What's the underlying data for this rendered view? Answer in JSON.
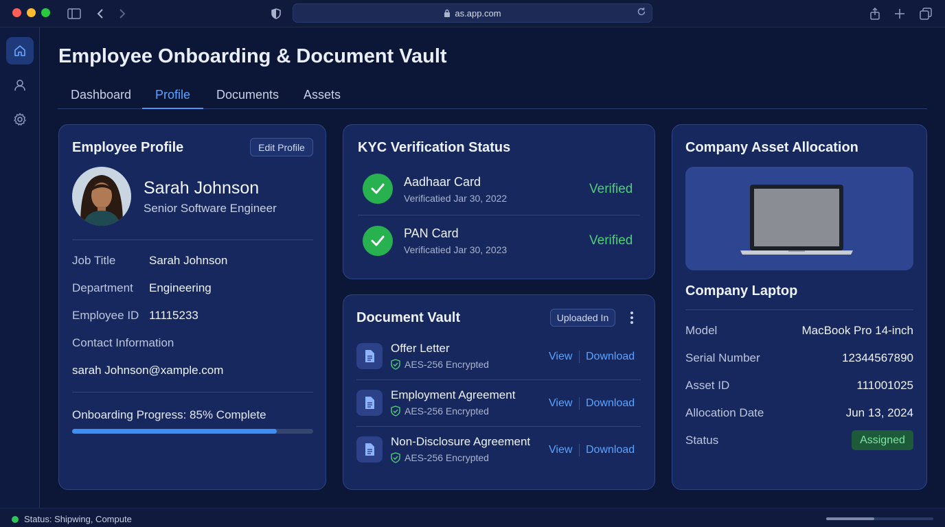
{
  "browser": {
    "url": "as.app.com"
  },
  "app": {
    "title": "Employee Onboarding & Document Vault",
    "tabs": [
      {
        "label": "Dashboard"
      },
      {
        "label": "Profile"
      },
      {
        "label": "Documents"
      },
      {
        "label": "Assets"
      }
    ],
    "active_tab": "Profile"
  },
  "sidebar": {
    "items": [
      {
        "icon": "home-icon"
      },
      {
        "icon": "user-icon"
      },
      {
        "icon": "gear-icon"
      }
    ]
  },
  "profile": {
    "title": "Employee Profile",
    "edit_label": "Edit Profile",
    "name": "Sarah Johnson",
    "role": "Senior Software Engineer",
    "fields": [
      {
        "label": "Job Title",
        "value": "Sarah Johnson"
      },
      {
        "label": "Department",
        "value": "Engineering"
      },
      {
        "label": "Employee ID",
        "value": "11115233"
      }
    ],
    "contact_label": "Contact Information",
    "email": "sarah Johnson@xample.com",
    "progress_label": "Onboarding Progress: 85% Complete",
    "progress_percent": 85
  },
  "kyc": {
    "title": "KYC Verification Status",
    "items": [
      {
        "name": "Aadhaar Card",
        "date": "Verificatied Jar 30, 2022",
        "status": "Verified"
      },
      {
        "name": "PAN Card",
        "date": "Verificatied Jar 30, 2023",
        "status": "Verified"
      }
    ]
  },
  "vault": {
    "title": "Document Vault",
    "filter_label": "Uploaded In",
    "view_label": "View",
    "download_label": "Download",
    "docs": [
      {
        "name": "Offer Letter",
        "encryption": "AES-256 Encrypted"
      },
      {
        "name": "Employment Agreement",
        "encryption": "AES-256 Encrypted"
      },
      {
        "name": "Non-Disclosure Agreement",
        "encryption": "AES-256 Encrypted"
      }
    ]
  },
  "asset": {
    "title": "Company Asset Allocation",
    "item_name": "Company Laptop",
    "fields": [
      {
        "label": "Model",
        "value": "MacBook Pro 14-inch"
      },
      {
        "label": "Serial Number",
        "value": "12344567890"
      },
      {
        "label": "Asset ID",
        "value": "111001025"
      },
      {
        "label": "Allocation Date",
        "value": "Jun 13, 2024"
      }
    ],
    "status_label": "Status",
    "status_value": "Assigned"
  },
  "statusbar": {
    "text": "Status: Shipwing, Compute"
  },
  "colors": {
    "accent": "#4e93f5",
    "verified": "#4fcf78",
    "background": "#0c1636",
    "card": "#17285e"
  }
}
